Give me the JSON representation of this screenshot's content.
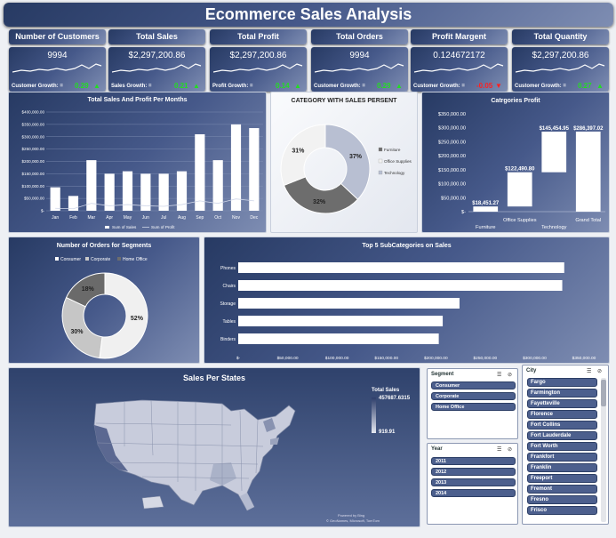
{
  "title": "Ecommerce Sales Analysis",
  "kpis": [
    {
      "label": "Number of Customers",
      "value": "9994",
      "growth_label": "Customer Growth: =",
      "growth": "0.29",
      "dir": "up"
    },
    {
      "label": "Total Sales",
      "value": "$2,297,200.86",
      "growth_label": "Sales Growth: =",
      "growth": "0.21",
      "dir": "up"
    },
    {
      "label": "Total Profit",
      "value": "$2,297,200.86",
      "growth_label": "Profit Growth: =",
      "growth": "0.14",
      "dir": "up"
    },
    {
      "label": "Total Orders",
      "value": "9994",
      "growth_label": "Customer Growth: =",
      "growth": "0.29",
      "dir": "up"
    },
    {
      "label": "Profit Margent",
      "value": "0.124672172",
      "growth_label": "Customer Growth: =",
      "growth": "-0.05",
      "dir": "down"
    },
    {
      "label": "Total Quantity",
      "value": "$2,297,200.86",
      "growth_label": "Customer Growth: =",
      "growth": "0.27",
      "dir": "up"
    }
  ],
  "colors": {
    "up": "#22dd22",
    "down": "#ff2020",
    "panel_dark": "#2f426c",
    "bar": "#ffffff"
  },
  "chart_data": [
    {
      "type": "bar",
      "title": "Total Sales And Profit Per Months",
      "categories": [
        "Jan",
        "Feb",
        "Mar",
        "Apr",
        "May",
        "Jun",
        "Jul",
        "Aug",
        "Sep",
        "Oct",
        "Nov",
        "Dec"
      ],
      "series": [
        {
          "name": "Sum of Sales",
          "values": [
            95000,
            60000,
            205000,
            150000,
            160000,
            150000,
            150000,
            160000,
            310000,
            205000,
            350000,
            335000
          ]
        },
        {
          "name": "Sum of Profit",
          "values": [
            10000,
            8000,
            30000,
            20000,
            25000,
            20000,
            18000,
            25000,
            40000,
            30000,
            48000,
            40000
          ]
        }
      ],
      "yticks": [
        "$-",
        "$50,000.00",
        "$100,000.00",
        "$150,000.00",
        "$200,000.00",
        "$250,000.00",
        "$300,000.00",
        "$350,000.00",
        "$400,000.00"
      ],
      "ylim": [
        0,
        400000
      ],
      "legend": "bottom"
    },
    {
      "type": "pie",
      "title": "CATEGORY WITH SALES PERSENT",
      "categories": [
        "Furniture",
        "Office Supplies",
        "Technology"
      ],
      "values": [
        32,
        31,
        37
      ],
      "labels": [
        "32%",
        "31%",
        "37%"
      ],
      "legend": "right"
    },
    {
      "type": "bar",
      "title": "Catrgories Profit",
      "categories": [
        "Furniture",
        "Office Supplies",
        "Technology",
        "Grand Total"
      ],
      "values": [
        18451.27,
        122490.8,
        145454.95,
        286397.02
      ],
      "labels": [
        "$18,451.27",
        "$122,490.80",
        "$145,454.95",
        "$286,397.02"
      ],
      "yticks": [
        "$-",
        "$50,000.00",
        "$100,000.00",
        "$150,000.00",
        "$200,000.00",
        "$250,000.00",
        "$300,000.00",
        "$350,000.00"
      ],
      "ylim": [
        0,
        350000
      ],
      "note": "waterfall"
    },
    {
      "type": "pie",
      "title": "Number of Orders for Segments",
      "categories": [
        "Consumer",
        "Corporate",
        "Home Office"
      ],
      "values": [
        52,
        30,
        18
      ],
      "labels": [
        "52%",
        "30%",
        "18%"
      ],
      "legend": "top"
    },
    {
      "type": "bar",
      "title": "Top 5 SubCategories on Sales",
      "categories": [
        "Phones",
        "Chairs",
        "Storage",
        "Tables",
        "Binders"
      ],
      "values": [
        330000,
        328000,
        224000,
        207000,
        203000
      ],
      "xticks": [
        "$-",
        "$50,000.00",
        "$100,000.00",
        "$150,000.00",
        "$200,000.00",
        "$250,000.00",
        "$300,000.00",
        "$350,000.00"
      ],
      "xlim": [
        0,
        350000
      ],
      "orientation": "horizontal"
    }
  ],
  "map": {
    "title": "Sales Per States",
    "legend_title": "Total Sales",
    "legend_max": "457687.6315",
    "legend_min": "919.91",
    "credit1": "Powered by Bing",
    "credit2": "© GeoNames, Microsoft, TomTom"
  },
  "slicers": {
    "segment": {
      "title": "Segment",
      "items": [
        "Consumer",
        "Corporate",
        "Home Office"
      ]
    },
    "year": {
      "title": "Year",
      "items": [
        "2011",
        "2012",
        "2013",
        "2014"
      ]
    },
    "city": {
      "title": "City",
      "items": [
        "Fargo",
        "Farmington",
        "Fayetteville",
        "Florence",
        "Fort Collins",
        "Fort Lauderdale",
        "Fort Worth",
        "Frankfort",
        "Franklin",
        "Freeport",
        "Fremont",
        "Fresno",
        "Frisco"
      ]
    }
  }
}
